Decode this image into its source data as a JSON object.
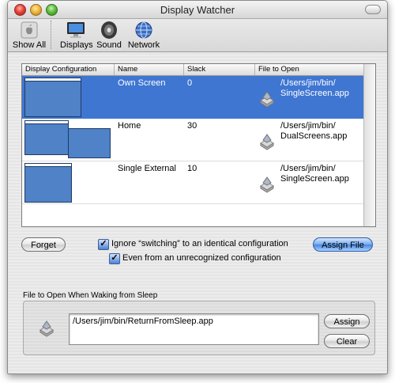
{
  "window": {
    "title": "Display Watcher"
  },
  "toolbar": {
    "items": [
      {
        "label": "Show All",
        "icon": "apple-icon"
      },
      {
        "label": "Displays",
        "icon": "monitor-icon"
      },
      {
        "label": "Sound",
        "icon": "speaker-icon"
      },
      {
        "label": "Network",
        "icon": "globe-icon"
      }
    ]
  },
  "table": {
    "headers": [
      "Display Configuration",
      "Name",
      "Slack",
      "File to Open"
    ],
    "rows": [
      {
        "name": "Own Screen",
        "slack": "0",
        "file": "/Users/jim/bin/\nSingleScreen.app",
        "selected": true,
        "config": "single"
      },
      {
        "name": "Home",
        "slack": "30",
        "file": "/Users/jim/bin/\nDualScreens.app",
        "selected": false,
        "config": "dual"
      },
      {
        "name": "Single External",
        "slack": "10",
        "file": "/Users/jim/bin/\nSingleScreen.app",
        "selected": false,
        "config": "single"
      }
    ]
  },
  "buttons": {
    "forget": "Forget",
    "assign_file": "Assign File",
    "assign": "Assign",
    "clear": "Clear"
  },
  "options": {
    "ignore_switching": {
      "label": "Ignore “switching” to an identical configuration",
      "checked": true
    },
    "even_unrecognized": {
      "label": "Even from an unrecognized configuration",
      "checked": true
    }
  },
  "sleep": {
    "group_title": "File to Open When Waking from Sleep",
    "path": "/Users/jim/bin/ReturnFromSleep.app"
  },
  "colors": {
    "selection": "#3f76d2",
    "screen_fill": "#4f82c6",
    "default_button": "#4b8ae0"
  }
}
